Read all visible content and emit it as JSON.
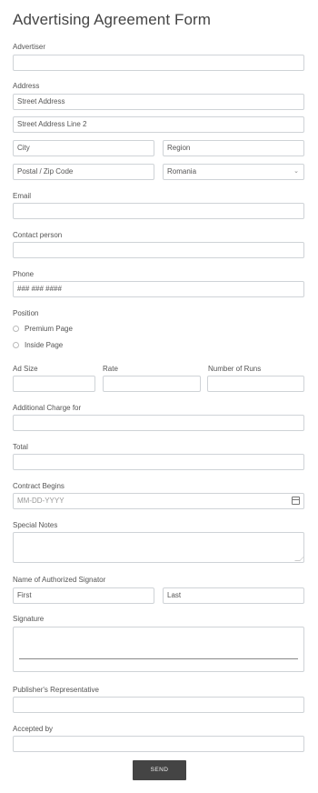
{
  "form": {
    "title": "Advertising Agreement Form",
    "advertiser": {
      "label": "Advertiser",
      "value": ""
    },
    "address": {
      "label": "Address",
      "street": "Street Address",
      "street2": "Street Address Line 2",
      "city": "City",
      "region": "Region",
      "postal": "Postal / Zip Code",
      "country": "Romania"
    },
    "email": {
      "label": "Email",
      "value": ""
    },
    "contact": {
      "label": "Contact person",
      "value": ""
    },
    "phone": {
      "label": "Phone",
      "value": "### ### ####"
    },
    "position": {
      "label": "Position",
      "options": [
        "Premium Page",
        "Inside Page"
      ]
    },
    "table": {
      "col1": "Ad Size",
      "col2": "Rate",
      "col3": "Number of Runs"
    },
    "additional": {
      "label": "Additional Charge for",
      "value": ""
    },
    "total": {
      "label": "Total",
      "value": ""
    },
    "contract": {
      "label": "Contract Begins",
      "placeholder": "MM-DD-YYYY"
    },
    "notes": {
      "label": "Special Notes",
      "value": ""
    },
    "signator": {
      "label": "Name of Authorized Signator",
      "first": "First",
      "last": "Last"
    },
    "signature": {
      "label": "Signature"
    },
    "publisher": {
      "label": "Publisher's Representative",
      "value": ""
    },
    "accepted": {
      "label": "Accepted by",
      "value": ""
    },
    "send_label": "SEND"
  },
  "colors": {
    "button": "#444444",
    "border": "#cfd3d7",
    "text": "#555555"
  }
}
